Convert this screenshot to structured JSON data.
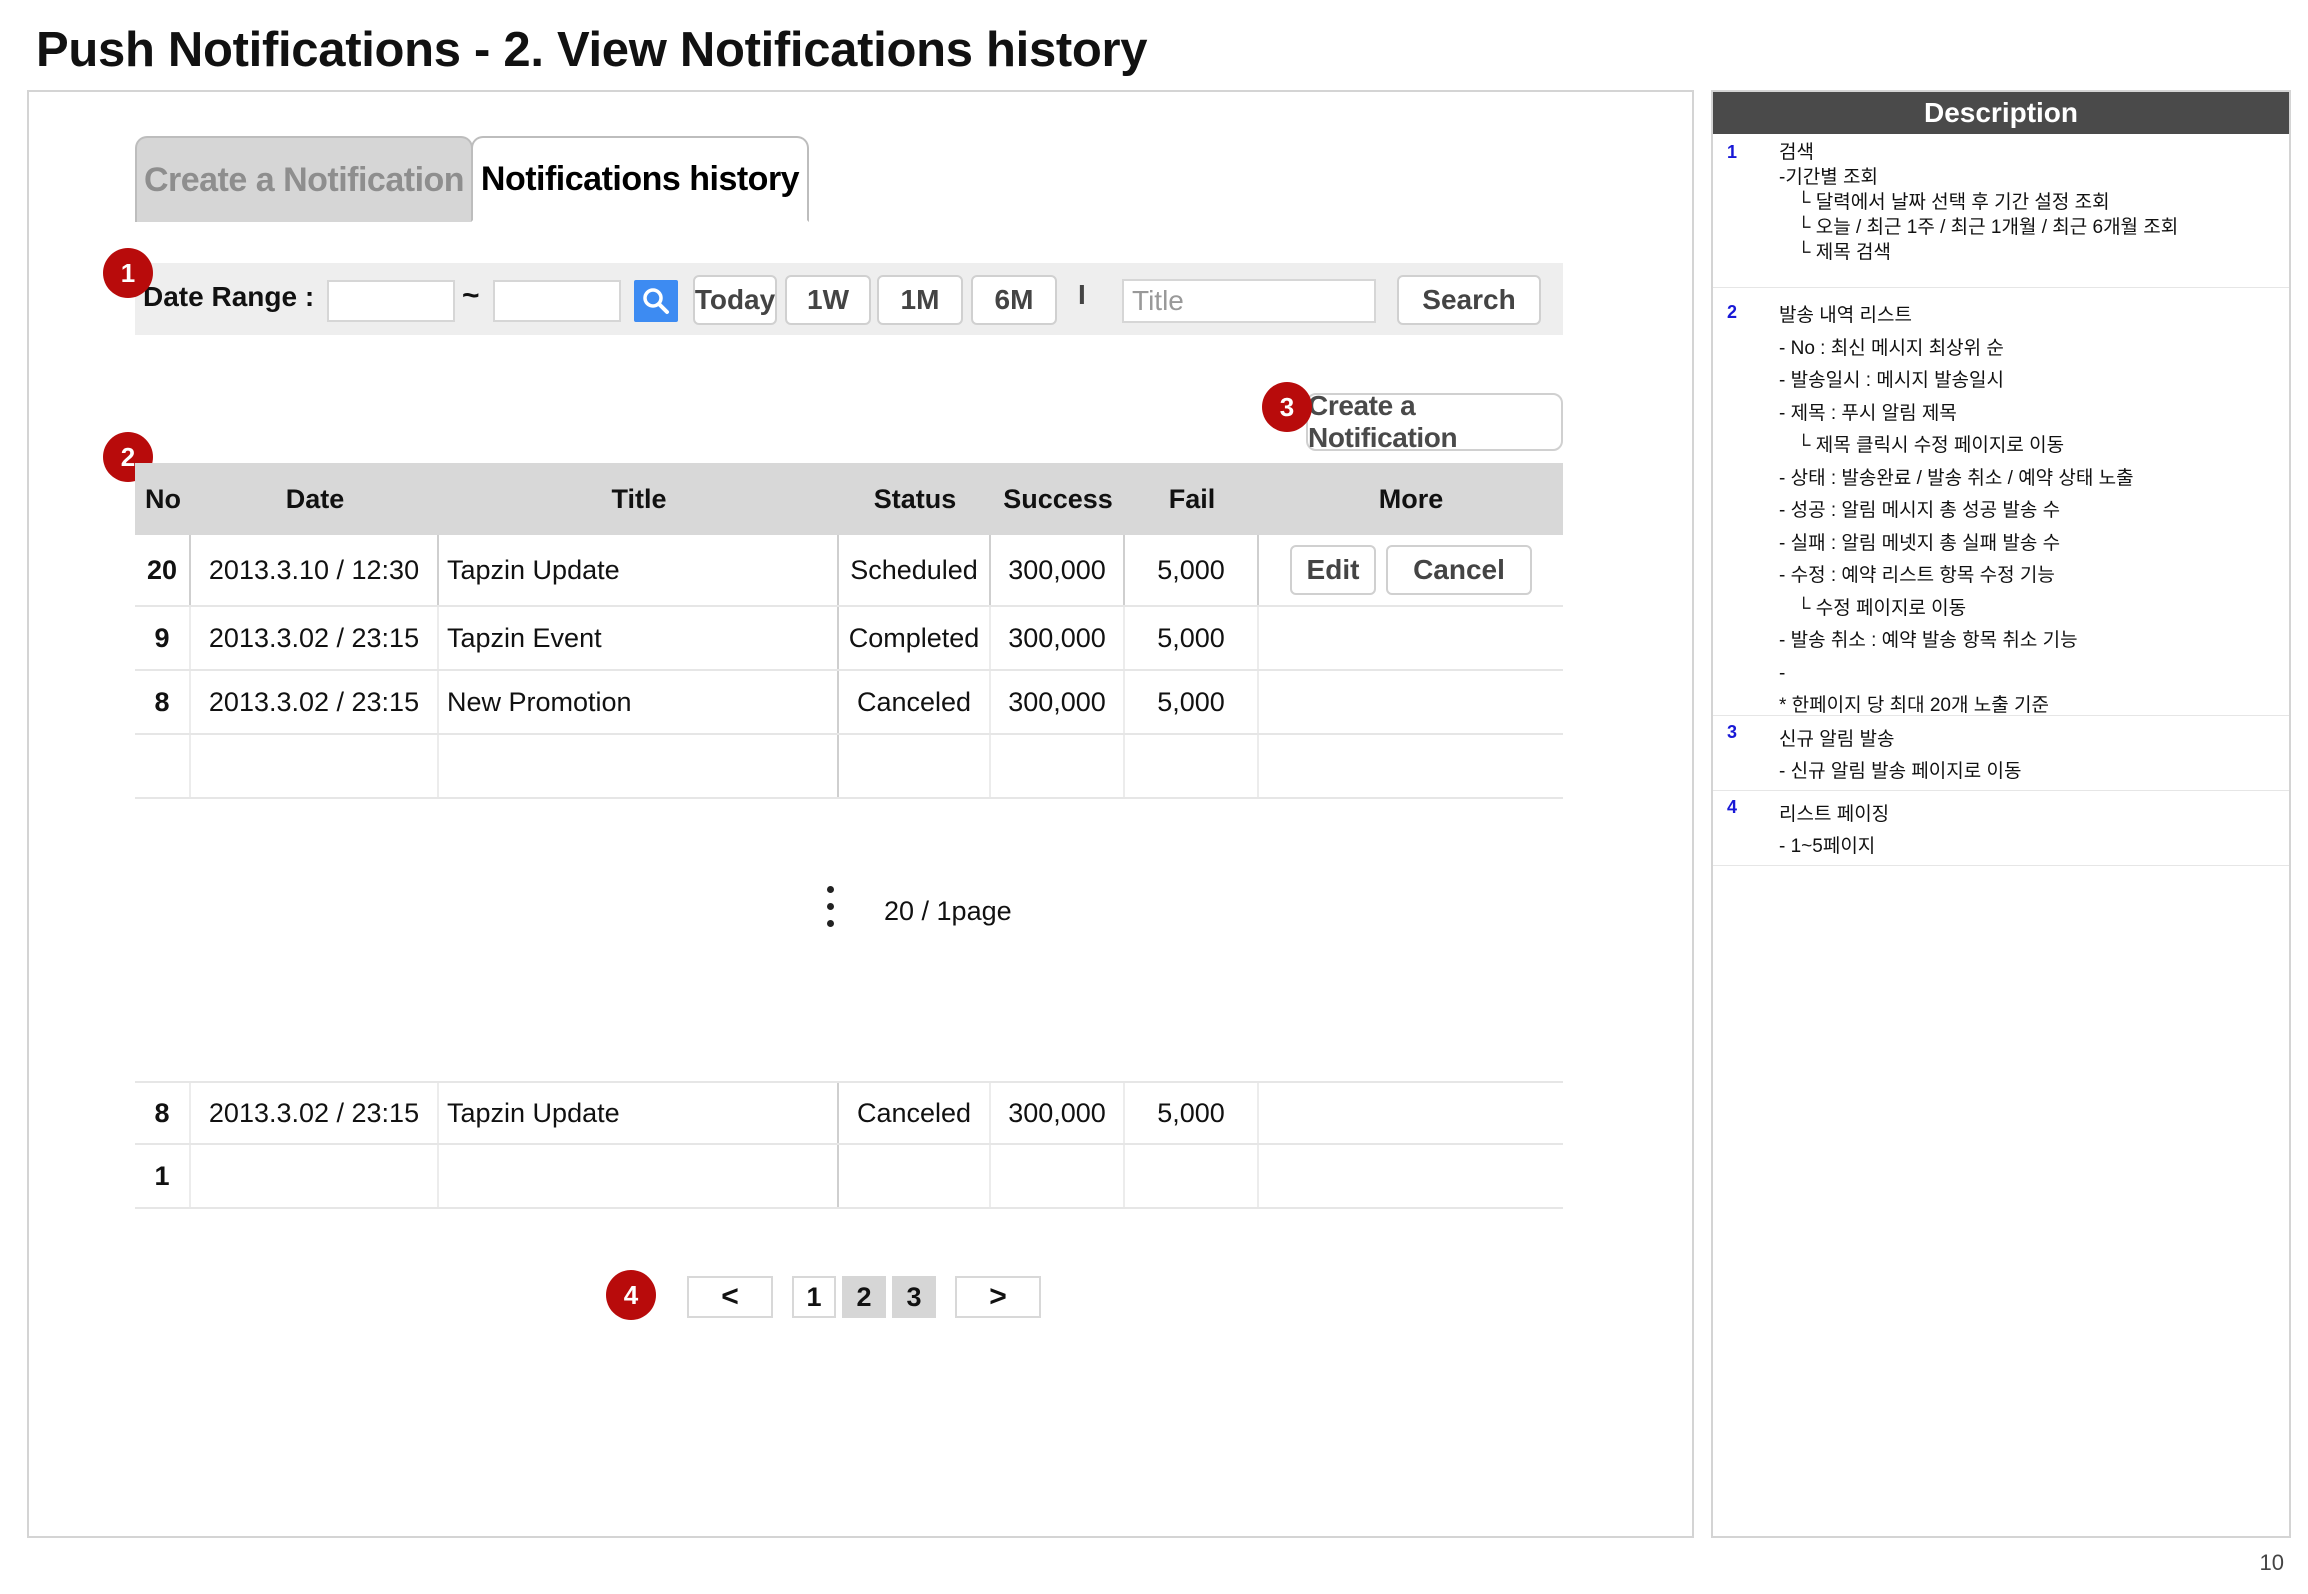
{
  "page": {
    "title": "Push Notifications - 2. View Notifications history",
    "page_number": "10"
  },
  "tabs": {
    "create": "Create a Notification",
    "history": "Notifications history"
  },
  "search": {
    "date_range_label": "Date Range :",
    "separator": "~",
    "buttons": [
      "Today",
      "1W",
      "1M",
      "6M"
    ],
    "divider": "I",
    "title_placeholder": "Title",
    "search_label": "Search"
  },
  "create_button": "Create a Notification",
  "markers": [
    "1",
    "2",
    "3",
    "4"
  ],
  "table": {
    "headers": [
      "No",
      "Date",
      "Title",
      "Status",
      "Success",
      "Fail",
      "More"
    ],
    "rows": [
      {
        "no": "20",
        "date": "2013.3.10 / 12:30",
        "title": "Tapzin Update",
        "status": "Scheduled",
        "success": "300,000",
        "fail": "5,000",
        "edit": "Edit",
        "cancel": "Cancel"
      },
      {
        "no": "9",
        "date": "2013.3.02 / 23:15",
        "title": "Tapzin Event",
        "status": "Completed",
        "success": "300,000",
        "fail": "5,000"
      },
      {
        "no": "8",
        "date": "2013.3.02 / 23:15",
        "title": "New Promotion",
        "status": "Canceled",
        "success": "300,000",
        "fail": "5,000"
      },
      {
        "no": "",
        "date": "",
        "title": "",
        "status": "",
        "success": "",
        "fail": ""
      }
    ],
    "bottom_rows": [
      {
        "no": "8",
        "date": "2013.3.02 / 23:15",
        "title": "Tapzin Update",
        "status": "Canceled",
        "success": "300,000",
        "fail": "5,000"
      },
      {
        "no": "1",
        "date": "",
        "title": "",
        "status": "",
        "success": "",
        "fail": ""
      }
    ],
    "page_count": "20 / 1page"
  },
  "pagination": {
    "prev": "<",
    "next": ">",
    "pages": [
      "1",
      "2",
      "3"
    ]
  },
  "description": {
    "header": "Description",
    "sections": [
      {
        "num": "1",
        "lines": [
          "검색",
          "-기간별 조회",
          "   └ 달력에서 날짜 선택 후 기간 설정 조회",
          "   └ 오늘 / 최근 1주 / 최근 1개월 / 최근 6개월 조회",
          "   └ 제목 검색"
        ]
      },
      {
        "num": "2",
        "lines": [
          "발송 내역 리스트",
          "- No : 최신 메시지 최상위 순",
          "- 발송일시 : 메시지 발송일시",
          "- 제목 : 푸시 알림 제목",
          "   └ 제목 클릭시 수정 페이지로 이동",
          "- 상태 : 발송완료 / 발송 취소 / 예약 상태 노출",
          "- 성공 : 알림 메시지 총 성공 발송 수",
          "- 실패 : 알림 메넷지 총 실패 발송 수",
          "- 수정 : 예약 리스트 항목 수정 기능",
          "   └ 수정 페이지로 이동",
          "- 발송 취소 : 예약 발송 항목 취소 기능",
          "-",
          "* 한페이지 당 최대 20개 노출 기준"
        ]
      },
      {
        "num": "3",
        "lines": [
          "신규 알림 발송",
          "- 신규 알림 발송 페이지로 이동"
        ]
      },
      {
        "num": "4",
        "lines": [
          "리스트 페이징",
          "- 1~5페이지"
        ]
      }
    ]
  }
}
